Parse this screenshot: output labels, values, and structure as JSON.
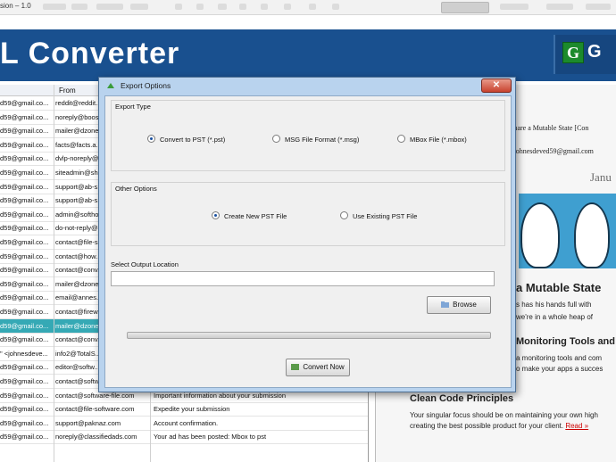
{
  "window": {
    "title_fragment": "sion – 1.0"
  },
  "app": {
    "title_fragment": "L Converter",
    "logo_letter": "G",
    "logo_text_fragment": "G"
  },
  "mail_list": {
    "from_header": "From",
    "rows": [
      {
        "a": "d59@gmail.co...",
        "from": "reddit@reddit....",
        "subject": "",
        "selected": false
      },
      {
        "a": "d59@gmail.co...",
        "from": "noreply@boost...",
        "subject": "",
        "selected": false
      },
      {
        "a": "d59@gmail.co...",
        "from": "mailer@dzone...",
        "subject": "",
        "selected": false
      },
      {
        "a": "d59@gmail.co...",
        "from": "facts@facts.a...",
        "subject": "",
        "selected": false
      },
      {
        "a": "d59@gmail.co...",
        "from": "dvlp-noreply@...",
        "subject": "",
        "selected": false
      },
      {
        "a": "d59@gmail.co...",
        "from": "siteadmin@sh...",
        "subject": "",
        "selected": false
      },
      {
        "a": "d59@gmail.co...",
        "from": "support@ab-s...",
        "subject": "",
        "selected": false
      },
      {
        "a": "d59@gmail.co...",
        "from": "support@ab-s...",
        "subject": "",
        "selected": false
      },
      {
        "a": "d59@gmail.co...",
        "from": "admin@softho...",
        "subject": "",
        "selected": false
      },
      {
        "a": "d59@gmail.co...",
        "from": "do-not-reply@...",
        "subject": "",
        "selected": false
      },
      {
        "a": "d59@gmail.co...",
        "from": "contact@file-s...",
        "subject": "",
        "selected": false
      },
      {
        "a": "d59@gmail.co...",
        "from": "contact@how...",
        "subject": "",
        "selected": false
      },
      {
        "a": "d59@gmail.co...",
        "from": "contact@conv...",
        "subject": "",
        "selected": false
      },
      {
        "a": "d59@gmail.co...",
        "from": "mailer@dzone...",
        "subject": "",
        "selected": false
      },
      {
        "a": "d59@gmail.co...",
        "from": "email@annes...",
        "subject": "",
        "selected": false
      },
      {
        "a": "d59@gmail.co...",
        "from": "contact@firew...",
        "subject": "",
        "selected": false
      },
      {
        "a": "d59@gmail.co...",
        "from": "mailer@dzone...",
        "subject": "",
        "selected": true
      },
      {
        "a": "d59@gmail.co...",
        "from": "contact@conv...",
        "subject": "",
        "selected": false
      },
      {
        "a": "\" <johnesdeve...",
        "from": "info2@TotalS...",
        "subject": "",
        "selected": false
      },
      {
        "a": "d59@gmail.co...",
        "from": "editor@softw...",
        "subject": "",
        "selected": false
      },
      {
        "a": "d59@gmail.co...",
        "from": "contact@softw...",
        "subject": "",
        "selected": false
      },
      {
        "a": "d59@gmail.co...",
        "from": "contact@software-file.com",
        "subject": "Important information about your submission",
        "selected": false
      },
      {
        "a": "d59@gmail.co...",
        "from": "contact@file-software.com",
        "subject": "Expedite your submission",
        "selected": false
      },
      {
        "a": "d59@gmail.co...",
        "from": "support@paknaz.com",
        "subject": "Account confirmation.",
        "selected": false
      },
      {
        "a": "d59@gmail.co...",
        "from": "noreply@classifiedads.com",
        "subject": "Your ad has been posted: Mbox to pst",
        "selected": false
      }
    ]
  },
  "preview": {
    "subject_fragment": "Share a Mutable State [Con",
    "from_fragment": "<johnesdeved59@gmail.com",
    "date_fragment": "Janu",
    "heading1": "a Mutable State",
    "line1": "s has his hands full with",
    "line2": "we're in a whole heap of",
    "heading2": "Monitoring Tools and T",
    "line3": "a monitoring tools and com",
    "line4": "o make your apps a succes",
    "heading3": "Clean Code Principles",
    "line5": "Your singular focus should be on maintaining your own high",
    "line6": "creating the best possible product for your client.",
    "read_more": "Read »"
  },
  "dialog": {
    "title": "Export Options",
    "close_glyph": "✕",
    "export_type_label": "Export Type",
    "export_options": [
      "Convert to PST (*.pst)",
      "MSG File Format (*.msg)",
      "MBox File (*.mbox)"
    ],
    "export_selected": 0,
    "other_options_label": "Other Options",
    "other_options": [
      "Create  New  PST  File",
      "Use Existing PST File"
    ],
    "other_selected": 0,
    "output_location_label": "Select Output Location",
    "output_path": "",
    "browse_label": "Browse",
    "convert_label": "Convert Now",
    "progress": 0.0
  },
  "colors": {
    "header_blue": "#19508f",
    "selected_row": "#35a9b5",
    "dialog_frame": "#b9d3ee",
    "logo_green": "#1c8a2c"
  }
}
